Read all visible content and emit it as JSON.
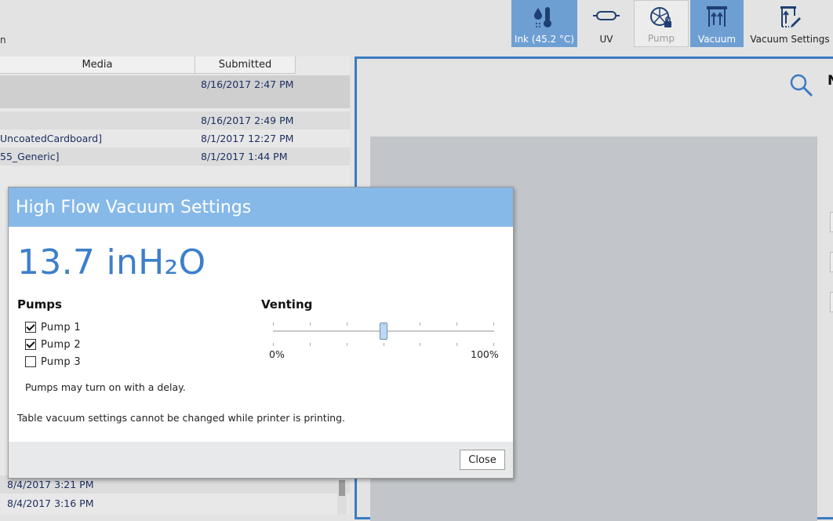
{
  "toolbar": {
    "left_text": "n",
    "buttons": [
      {
        "label": "Ink (45.2 °C)",
        "icon": "ink-thermometer-icon",
        "state": "active"
      },
      {
        "label": "UV",
        "icon": "uv-lamp-icon",
        "state": "normal"
      },
      {
        "label": "Pump",
        "icon": "pump-icon",
        "state": "disabled"
      },
      {
        "label": "Vacuum",
        "icon": "vacuum-icon",
        "state": "active"
      },
      {
        "label": "Vacuum Settings",
        "icon": "vacuum-settings-icon",
        "state": "normal"
      }
    ]
  },
  "job_list": {
    "columns": [
      "Media",
      "Submitted"
    ],
    "rows": [
      {
        "media": "",
        "submitted": "8/16/2017 2:47 PM"
      },
      {
        "media": "",
        "submitted": "8/16/2017 2:49 PM"
      },
      {
        "media": "UncoatedCardboard]",
        "submitted": "8/1/2017 12:27 PM"
      },
      {
        "media": "55_Generic]",
        "submitted": "8/1/2017 1:44 PM"
      },
      {
        "media": "",
        "submitted": "8/4/2017 3:21 PM"
      },
      {
        "media": "",
        "submitted": "8/4/2017 3:16 PM"
      }
    ]
  },
  "preview": {
    "title": "N"
  },
  "dialog": {
    "title": "High Flow Vacuum Settings",
    "reading": "13.7 inH₂O",
    "pumps_heading": "Pumps",
    "pumps": [
      {
        "label": "Pump 1",
        "checked": true
      },
      {
        "label": "Pump 2",
        "checked": true
      },
      {
        "label": "Pump 3",
        "checked": false
      }
    ],
    "venting_heading": "Venting",
    "venting_level": 0.5,
    "venting_min_label": "0%",
    "venting_max_label": "100%",
    "pump_delay_note": "Pumps may turn on with a delay.",
    "printing_note": "Table vacuum settings cannot be changed while printer is printing.",
    "close_label": "Close"
  },
  "colors": {
    "accent": "#3b7bc2",
    "toolbar_active": "#6e9fd3",
    "dialog_title_bg": "#86b9e8",
    "reading_text": "#3d7fcb"
  }
}
